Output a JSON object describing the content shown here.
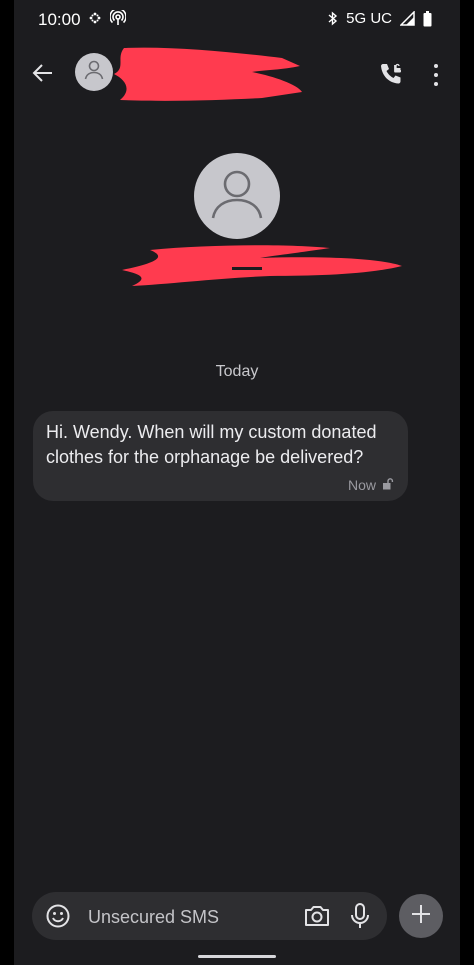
{
  "status_bar": {
    "time": "10:00",
    "network": "5G UC",
    "icons": [
      "slack-icon",
      "hotspot-icon",
      "bluetooth-icon",
      "signal-icon",
      "battery-icon"
    ]
  },
  "header": {
    "contact_name": "",
    "icons": [
      "back-arrow-icon",
      "avatar-icon",
      "phone-call-icon",
      "more-vert-icon"
    ]
  },
  "conversation": {
    "date_label": "Today",
    "messages": [
      {
        "text": "Hi. Wendy. When will my custom donated clothes for the orphanage be delivered?",
        "time": "Now",
        "status_icon": "unlocked-icon"
      }
    ]
  },
  "compose": {
    "placeholder": "Unsecured SMS",
    "icons": [
      "emoji-icon",
      "camera-icon",
      "mic-icon",
      "plus-icon"
    ]
  },
  "colors": {
    "background": "#1c1c1f",
    "bubble": "#2e2e31",
    "redaction": "#ff3b4f",
    "avatar": "#c7c7cc"
  }
}
